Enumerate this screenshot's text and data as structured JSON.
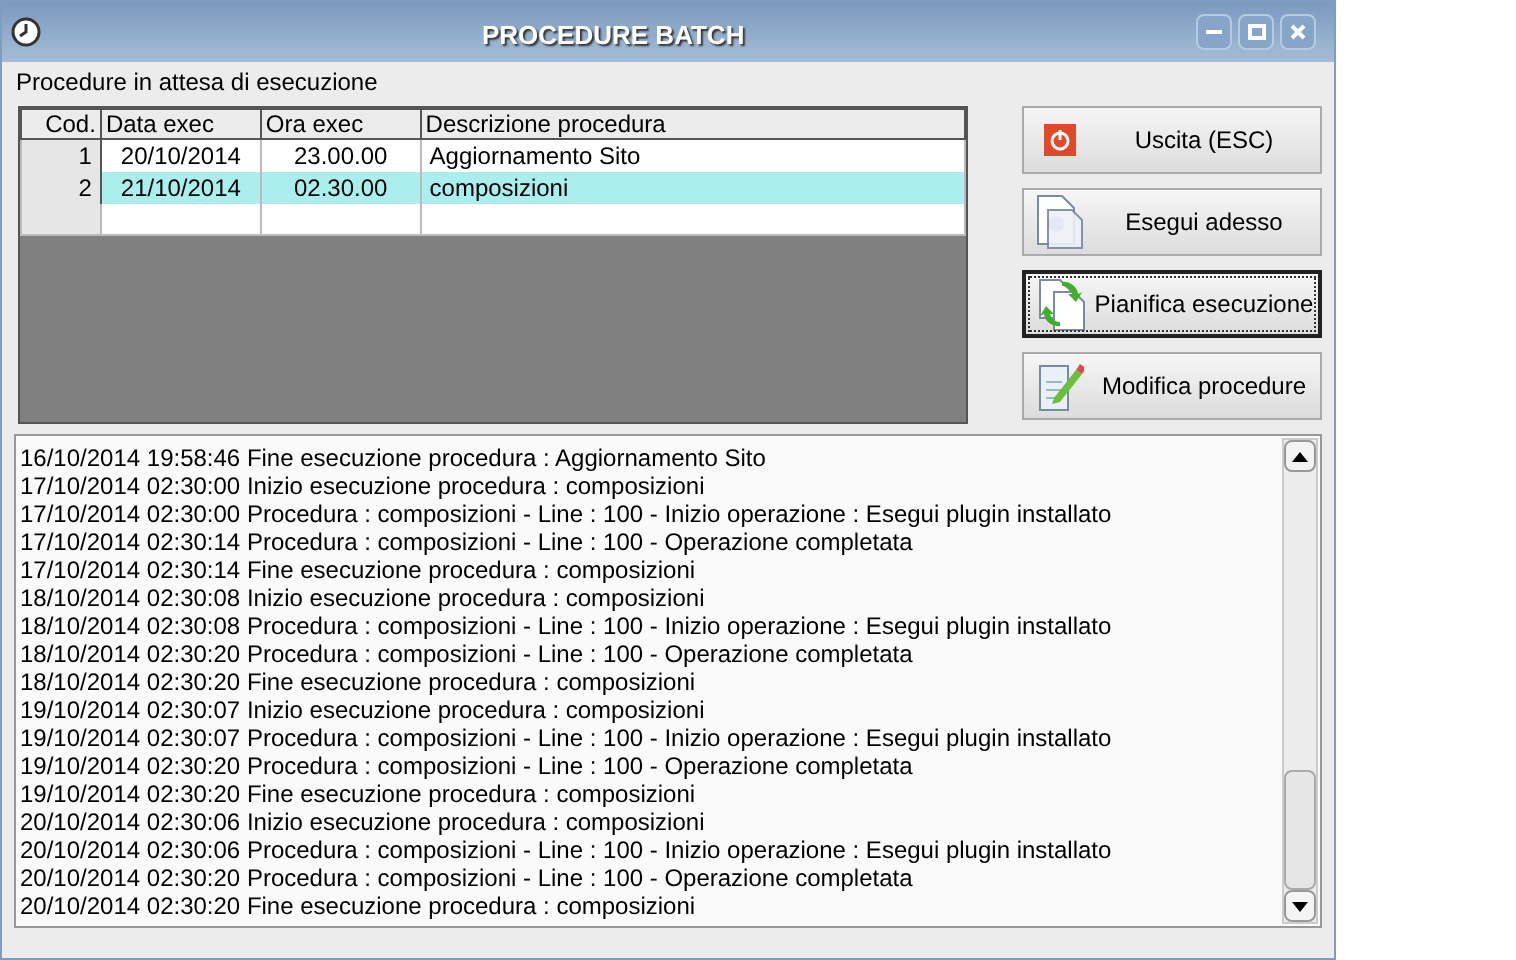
{
  "window": {
    "title": "PROCEDURE BATCH"
  },
  "section_label": "Procedure in attesa di esecuzione",
  "table": {
    "columns": [
      "Cod.",
      "Data exec",
      "Ora exec",
      "Descrizione procedura"
    ],
    "rows": [
      {
        "cells": [
          "1",
          "20/10/2014",
          "23.00.00",
          "Aggiornamento Sito"
        ],
        "selected": false
      },
      {
        "cells": [
          "2",
          "21/10/2014",
          "02.30.00",
          "composizioni"
        ],
        "selected": true
      }
    ]
  },
  "buttons": [
    {
      "label": "Uscita (ESC)",
      "kind": "exit",
      "focused": false
    },
    {
      "label": "Esegui adesso",
      "kind": "run",
      "focused": false
    },
    {
      "label": "Pianifica esecuzione",
      "kind": "schedule",
      "focused": true
    },
    {
      "label": "Modifica procedure",
      "kind": "edit",
      "focused": false
    }
  ],
  "log": [
    "16/10/2014 19:58:46 Fine esecuzione procedura : Aggiornamento Sito",
    "17/10/2014 02:30:00 Inizio esecuzione procedura : composizioni",
    "17/10/2014 02:30:00 Procedura : composizioni - Line : 100 - Inizio operazione : Esegui plugin installato",
    "17/10/2014 02:30:14 Procedura : composizioni - Line : 100 - Operazione completata",
    "17/10/2014 02:30:14 Fine esecuzione procedura : composizioni",
    "18/10/2014 02:30:08 Inizio esecuzione procedura : composizioni",
    "18/10/2014 02:30:08 Procedura : composizioni - Line : 100 - Inizio operazione : Esegui plugin installato",
    "18/10/2014 02:30:20 Procedura : composizioni - Line : 100 - Operazione completata",
    "18/10/2014 02:30:20 Fine esecuzione procedura : composizioni",
    "19/10/2014 02:30:07 Inizio esecuzione procedura : composizioni",
    "19/10/2014 02:30:07 Procedura : composizioni - Line : 100 - Inizio operazione : Esegui plugin installato",
    "19/10/2014 02:30:20 Procedura : composizioni - Line : 100 - Operazione completata",
    "19/10/2014 02:30:20 Fine esecuzione procedura : composizioni",
    "20/10/2014 02:30:06 Inizio esecuzione procedura : composizioni",
    "20/10/2014 02:30:06 Procedura : composizioni - Line : 100 - Inizio operazione : Esegui plugin installato",
    "20/10/2014 02:30:20 Procedura : composizioni - Line : 100 - Operazione completata",
    "20/10/2014 02:30:20 Fine esecuzione procedura : composizioni"
  ]
}
